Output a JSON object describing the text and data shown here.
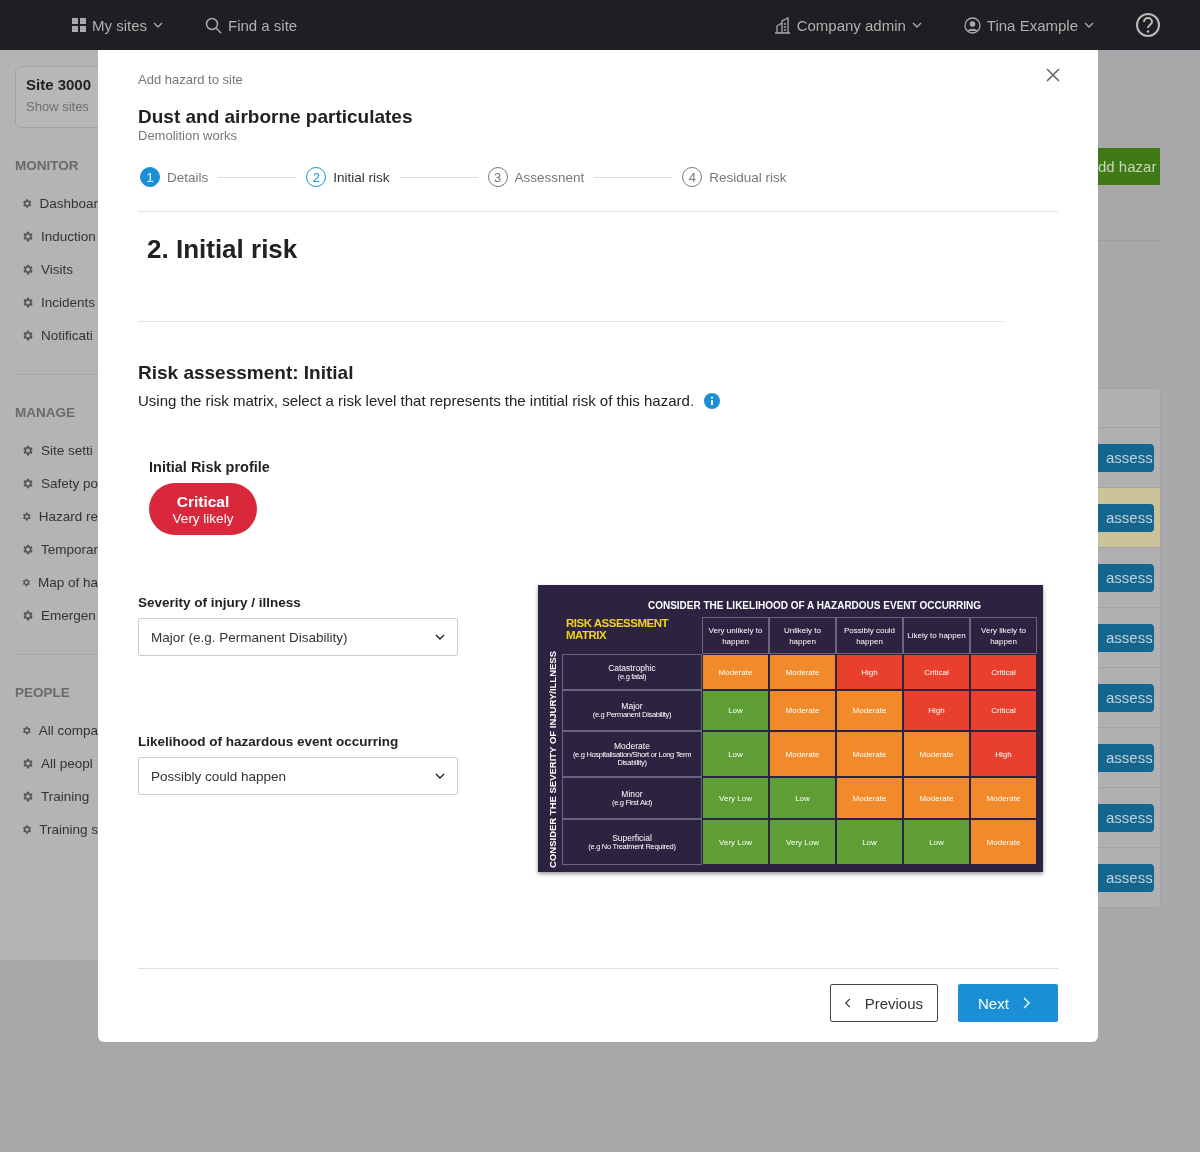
{
  "top_bar": {
    "left": [
      {
        "kind": "sites",
        "label": "My sites"
      },
      {
        "kind": "search",
        "label": "Find a site"
      }
    ],
    "right": [
      {
        "kind": "company",
        "label": "Company admin"
      },
      {
        "kind": "user",
        "label": "Tina Example"
      }
    ]
  },
  "sidebar": {
    "site": {
      "name": "Site 3000",
      "link": "Show sites"
    },
    "sections": [
      {
        "heading": "MONITOR",
        "items": [
          "Dashboar",
          "Induction",
          "Visits",
          "Incidents",
          "Notificati"
        ]
      },
      {
        "heading": "MANAGE",
        "items": [
          "Site setti",
          "Safety po",
          "Hazard re",
          "Temporar",
          "Map of ha",
          "Emergen"
        ]
      },
      {
        "heading": "PEOPLE",
        "items": [
          "All compa",
          "All peopl",
          "Training",
          "Training s"
        ]
      }
    ]
  },
  "background_panel": {
    "add_button": "dd hazar",
    "rows": [
      {
        "action": "assess",
        "highlighted": false
      },
      {
        "action": "assess",
        "highlighted": true
      },
      {
        "action": "assess",
        "highlighted": false
      },
      {
        "action": "assess",
        "highlighted": false
      },
      {
        "action": "assess",
        "highlighted": false
      },
      {
        "action": "assess",
        "highlighted": false
      },
      {
        "action": "assess",
        "highlighted": false
      },
      {
        "action": "assess",
        "highlighted": false
      }
    ]
  },
  "modal": {
    "caption": "Add hazard to site",
    "title": "Dust and airborne particulates",
    "subtitle": "Demolition works",
    "steps": [
      {
        "number": "1",
        "label": "Details",
        "completed": true,
        "selected": false
      },
      {
        "number": "2",
        "label": "Initial risk",
        "completed": false,
        "selected": true
      },
      {
        "number": "3",
        "label": "Assessnent",
        "completed": false,
        "selected": false
      },
      {
        "number": "4",
        "label": "Residual risk",
        "completed": false,
        "selected": false
      }
    ],
    "section_heading": "2. Initial risk",
    "assessment_heading": "Risk assessment: Initial",
    "instructions": "Using the risk matrix, select a risk level that represents the intitial risk of this hazard.",
    "profile": {
      "label": "Initial Risk profile",
      "level": "Critical",
      "likelihood": "Very likely",
      "color": "#d9283c"
    },
    "fields": [
      {
        "label": "Severity of injury / illness",
        "value": "Major (e.g. Permanent Disability)"
      },
      {
        "label": "Likelihood of hazardous event occurring",
        "value": "Possibly could happen"
      }
    ],
    "matrix": {
      "title": "CONSIDER THE LIKELIHOOD OF A HAZARDOUS EVENT OCCURRING",
      "corner": "RISK ASSESSMENT MATRIX",
      "side_label": "CONSIDER THE SEVERITY OF INJURY/ILLNESS",
      "columns": [
        "Very unlikely to happen",
        "Unlikely to happen",
        "Possibly could happen",
        "Likely to happen",
        "Very likely to happen"
      ],
      "rows": [
        {
          "label": "Catastrophic",
          "example": "(e.g fatal)",
          "cells": [
            {
              "text": "Moderate",
              "color": "#f08a2a"
            },
            {
              "text": "Moderate",
              "color": "#f08a2a"
            },
            {
              "text": "High",
              "color": "#e8402c"
            },
            {
              "text": "Critical",
              "color": "#e8402c"
            },
            {
              "text": "Critical",
              "color": "#e8402c"
            }
          ]
        },
        {
          "label": "Major",
          "example": "(e.g Permanent Disability)",
          "cells": [
            {
              "text": "Low",
              "color": "#5e9e34"
            },
            {
              "text": "Moderate",
              "color": "#f08a2a"
            },
            {
              "text": "Moderate",
              "color": "#f08a2a"
            },
            {
              "text": "High",
              "color": "#e8402c"
            },
            {
              "text": "Critical",
              "color": "#e8402c"
            }
          ]
        },
        {
          "label": "Moderate",
          "example": "(e.g Hospitalisation/Short or Long Term Disability)",
          "cells": [
            {
              "text": "Low",
              "color": "#5e9e34"
            },
            {
              "text": "Moderate",
              "color": "#f08a2a"
            },
            {
              "text": "Moderate",
              "color": "#f08a2a"
            },
            {
              "text": "Moderate",
              "color": "#f08a2a"
            },
            {
              "text": "High",
              "color": "#e8402c"
            }
          ]
        },
        {
          "label": "Minor",
          "example": "(e.g First Aid)",
          "cells": [
            {
              "text": "Very Low",
              "color": "#5e9e34"
            },
            {
              "text": "Low",
              "color": "#5e9e34"
            },
            {
              "text": "Moderate",
              "color": "#f08a2a"
            },
            {
              "text": "Moderate",
              "color": "#f08a2a"
            },
            {
              "text": "Moderate",
              "color": "#f08a2a"
            }
          ]
        },
        {
          "label": "Superficial",
          "example": "(e.g No Treatment Required)",
          "cells": [
            {
              "text": "Very Low",
              "color": "#5e9e34"
            },
            {
              "text": "Very Low",
              "color": "#5e9e34"
            },
            {
              "text": "Low",
              "color": "#5e9e34"
            },
            {
              "text": "Low",
              "color": "#5e9e34"
            },
            {
              "text": "Moderate",
              "color": "#f08a2a"
            }
          ]
        }
      ]
    },
    "buttons": [
      {
        "kind": "previous",
        "label": "Previous"
      },
      {
        "kind": "next",
        "label": "Next"
      }
    ]
  }
}
